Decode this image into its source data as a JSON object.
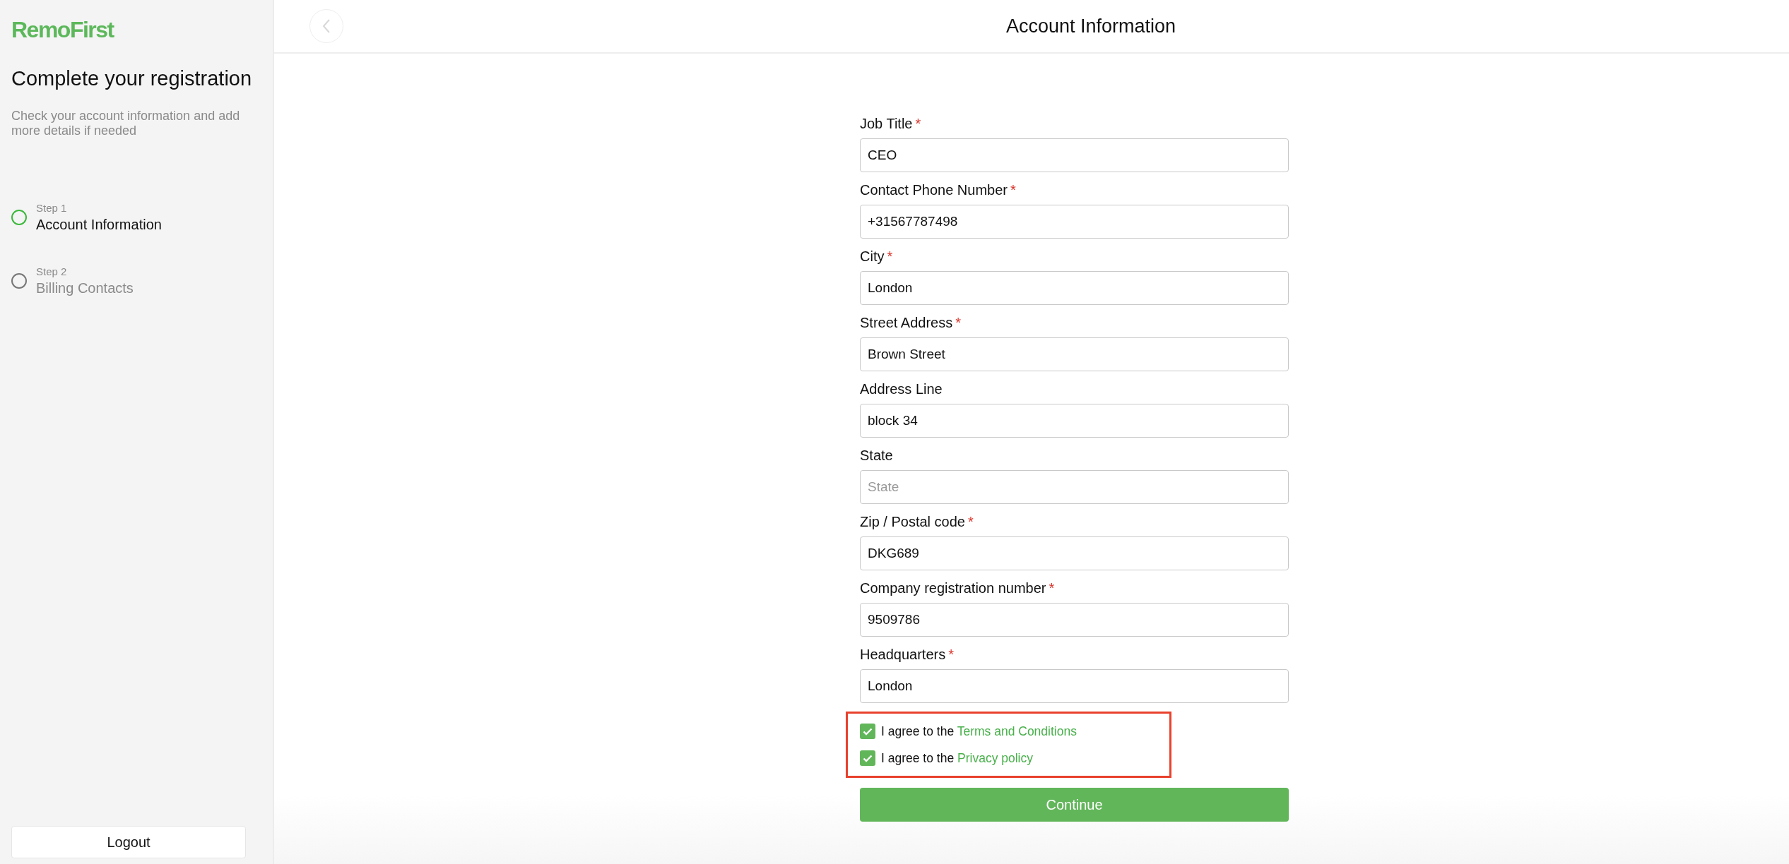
{
  "sidebar": {
    "logo": "RemoFirst",
    "title": "Complete your registration",
    "subtitle": "Check your account information and add more details if needed",
    "steps": [
      {
        "step": "Step 1",
        "label": "Account Information",
        "selected": true
      },
      {
        "step": "Step 2",
        "label": "Billing Contacts",
        "selected": false
      }
    ],
    "logout": "Logout"
  },
  "header": {
    "title": "Account Information"
  },
  "fields": [
    {
      "label": "Job Title",
      "required_mark": "*",
      "value": "CEO"
    },
    {
      "label": "Contact Phone Number",
      "required_mark": "*",
      "value": "+31567787498"
    },
    {
      "label": "City",
      "required_mark": "*",
      "value": "London"
    },
    {
      "label": "Street Address",
      "required_mark": "*",
      "value": "Brown Street"
    },
    {
      "label": "Address Line",
      "value": "block 34"
    },
    {
      "label": "State",
      "placeholder": "State"
    },
    {
      "label": "Zip / Postal code",
      "required_mark": "*",
      "value": "DKG689"
    },
    {
      "label": "Company registration number",
      "required_mark": "*",
      "value": "9509786"
    },
    {
      "label": "Headquarters",
      "required_mark": "*",
      "value": "London"
    }
  ],
  "agreements": [
    {
      "text": "I agree to the",
      "link": "Terms and Conditions",
      "checked": true
    },
    {
      "text": "I agree to the",
      "link": "Privacy policy",
      "checked": true
    }
  ],
  "continue": "Continue"
}
